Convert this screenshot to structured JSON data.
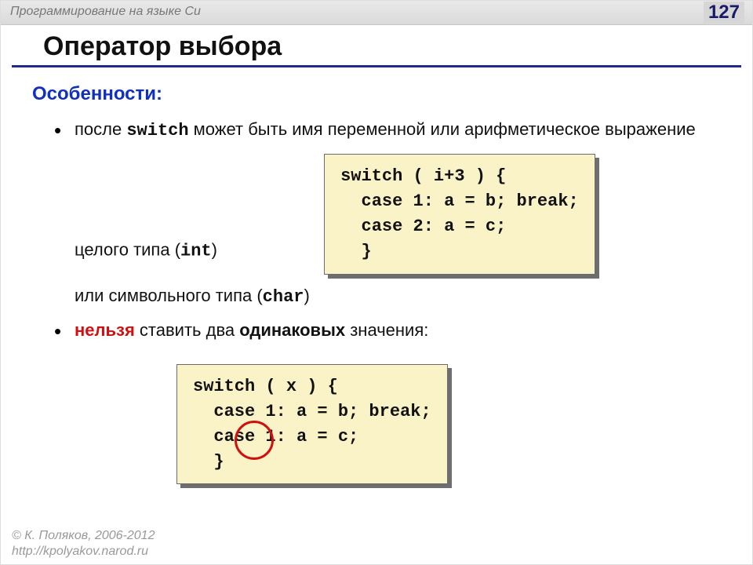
{
  "header": {
    "course": "Программирование на языке Си",
    "page": "127"
  },
  "title": "Оператор выбора",
  "section_heading": "Особенности:",
  "bullet1": {
    "pre": "после ",
    "kw1": "switch",
    "mid": " может быть имя переменной или арифметическое выражение целого типа (",
    "kw2": "int",
    "post": ")"
  },
  "code1": "switch ( i+3 ) {\n  case 1: a = b; break;\n  case 2: a = c;\n  }",
  "aftercode1": {
    "pre": "или символьного типа (",
    "kw": "char",
    "post": ")"
  },
  "bullet2": {
    "w1": "нельзя",
    "mid1": " ставить два ",
    "w2": "одинаковых",
    "mid2": " значения:"
  },
  "code2": "switch ( x ) {\n  case 1: a = b; break;\n  case 1: a = c;\n  }",
  "footer": {
    "line1": "© К. Поляков, 2006-2012",
    "line2": "http://kpolyakov.narod.ru"
  }
}
